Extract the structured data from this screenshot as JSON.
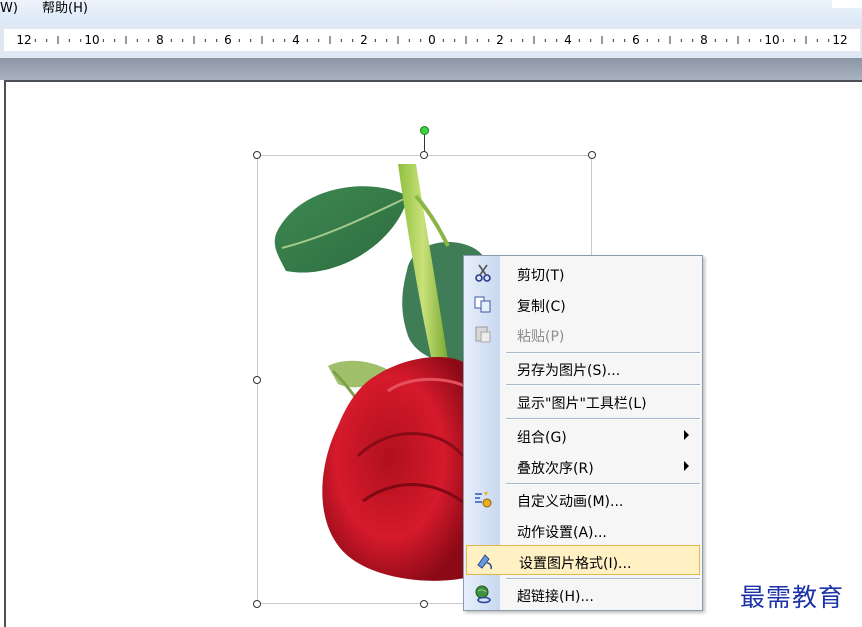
{
  "menubar": {
    "items": [
      {
        "label": "W)"
      },
      {
        "label": "帮助(H)"
      }
    ]
  },
  "ruler": {
    "labels": [
      "12",
      "10",
      "8",
      "6",
      "4",
      "2",
      "0",
      "2",
      "4",
      "6",
      "8",
      "10",
      "12"
    ]
  },
  "context_menu": {
    "items": [
      {
        "label": "剪切(T)",
        "icon": "scissors-icon",
        "state": "normal"
      },
      {
        "label": "复制(C)",
        "icon": "copy-icon",
        "state": "normal"
      },
      {
        "label": "粘贴(P)",
        "icon": "paste-icon",
        "state": "disabled"
      },
      {
        "label": "另存为图片(S)...",
        "icon": "",
        "state": "normal"
      },
      {
        "label": "显示\"图片\"工具栏(L)",
        "icon": "",
        "state": "normal"
      },
      {
        "label": "组合(G)",
        "icon": "",
        "state": "submenu"
      },
      {
        "label": "叠放次序(R)",
        "icon": "",
        "state": "submenu"
      },
      {
        "label": "自定义动画(M)...",
        "icon": "custom-animation-icon",
        "state": "normal"
      },
      {
        "label": "动作设置(A)...",
        "icon": "",
        "state": "normal"
      },
      {
        "label": "设置图片格式(I)...",
        "icon": "format-picture-icon",
        "state": "highlighted"
      },
      {
        "label": "超链接(H)...",
        "icon": "hyperlink-icon",
        "state": "normal"
      }
    ]
  },
  "watermark": {
    "text": "最需教育"
  },
  "colors": {
    "menu_highlight": "#fff1c4",
    "menu_highlight_border": "#e3b84a",
    "watermark": "#1b33a6"
  }
}
